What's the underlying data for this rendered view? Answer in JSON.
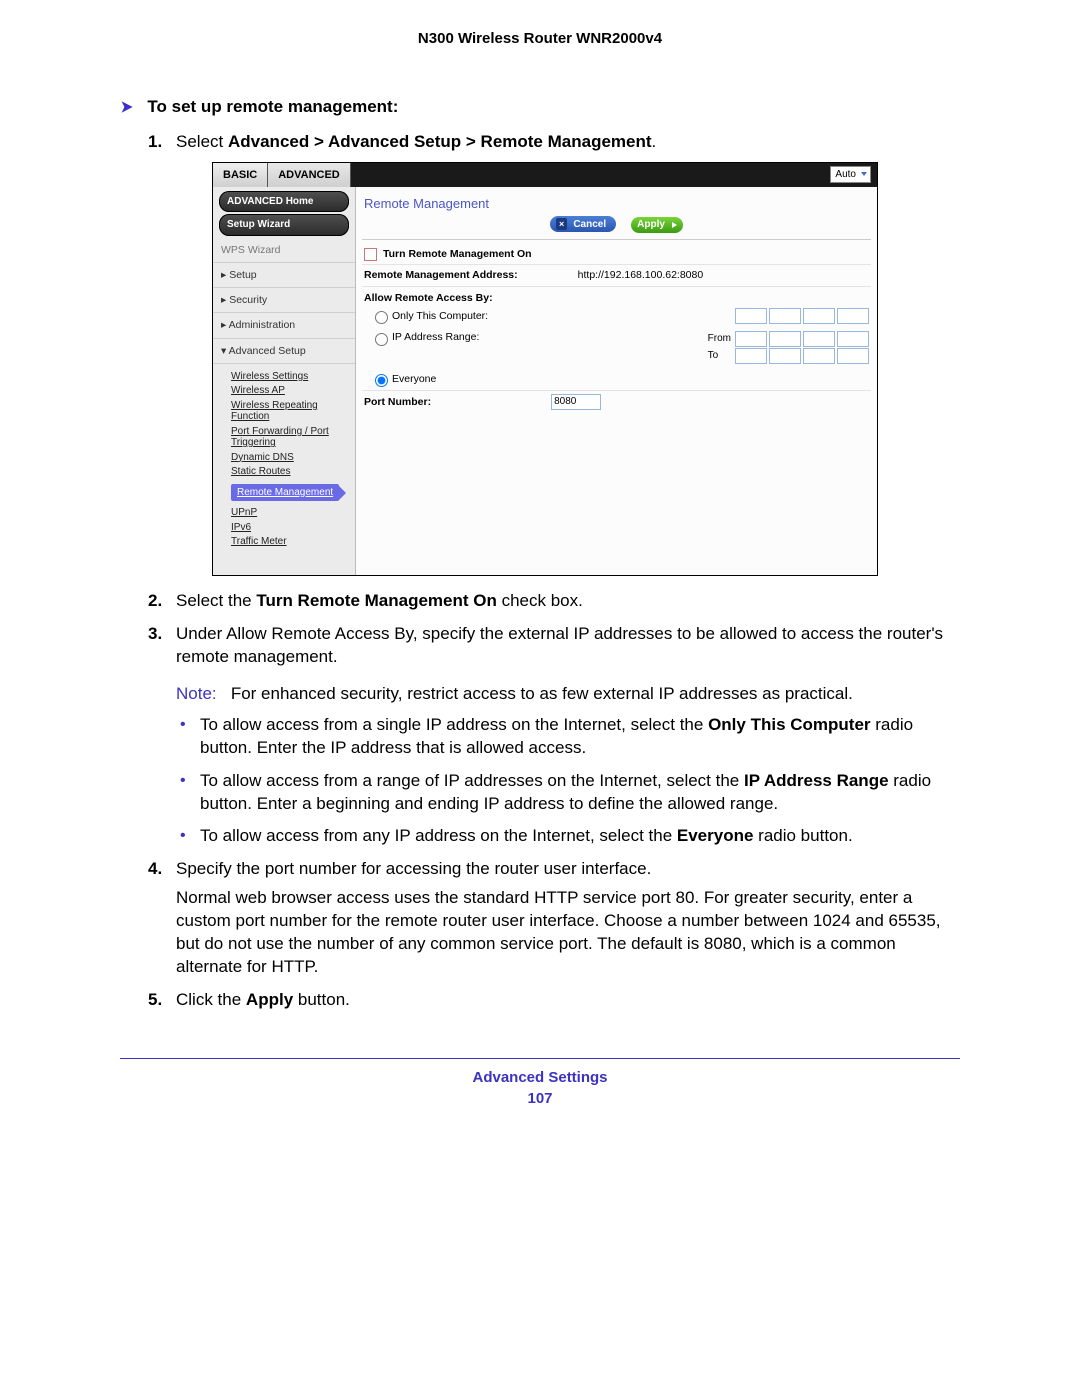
{
  "header": {
    "title": "N300 Wireless Router WNR2000v4"
  },
  "procedure": {
    "heading": "To set up remote management:"
  },
  "steps": {
    "s1": {
      "num": "1.",
      "pre": "Select ",
      "bold": "Advanced > Advanced Setup > Remote Management",
      "post": "."
    },
    "s2": {
      "num": "2.",
      "pre": "Select the ",
      "bold": "Turn Remote Management On",
      "post": " check box."
    },
    "s3": {
      "num": "3.",
      "text": "Under Allow Remote Access By, specify the external IP addresses to be allowed to access the router's remote management.",
      "note_label": "Note:",
      "note_text": "For enhanced security, restrict access to as few external IP addresses as practical.",
      "bullets": {
        "b1": {
          "pre": "To allow access from a single IP address on the Internet, select the ",
          "bold": "Only This Computer",
          "post": " radio button. Enter the IP address that is allowed access."
        },
        "b2": {
          "pre": "To allow access from a range of IP addresses on the Internet, select the ",
          "bold": "IP Address Range",
          "post": " radio button. Enter a beginning and ending IP address to define the allowed range."
        },
        "b3": {
          "pre": "To allow access from any IP address on the Internet, select the ",
          "bold": "Everyone",
          "post": " radio button."
        }
      }
    },
    "s4": {
      "num": "4.",
      "text": "Specify the port number for accessing the router user interface.",
      "para": "Normal web browser access uses the standard HTTP service port 80. For greater security, enter a custom port number for the remote router user interface. Choose a number between 1024 and 65535, but do not use the number of any common service port. The default is 8080, which is a common alternate for HTTP."
    },
    "s5": {
      "num": "5.",
      "pre": "Click the ",
      "bold": "Apply",
      "post": " button."
    }
  },
  "router": {
    "tabs": {
      "basic": "BASIC",
      "advanced": "ADVANCED"
    },
    "lang": "Auto",
    "pills": {
      "home": "ADVANCED Home",
      "wizard": "Setup Wizard"
    },
    "nav": {
      "wps": "WPS Wizard",
      "setup": "▸ Setup",
      "security": "▸ Security",
      "admin": "▸ Administration",
      "advsetup": "▾ Advanced Setup"
    },
    "sub": {
      "ws": "Wireless Settings",
      "ap": "Wireless AP",
      "wrf": "Wireless Repeating Function",
      "pf": "Port Forwarding / Port Triggering",
      "ddns": "Dynamic DNS",
      "sr": "Static Routes",
      "rm": "Remote Management",
      "upnp": "UPnP",
      "ipv6": "IPv6",
      "tm": "Traffic Meter"
    },
    "content": {
      "title": "Remote Management",
      "cancel": "Cancel",
      "apply": "Apply",
      "turn_on": "Turn Remote Management On",
      "addr_label": "Remote Management Address:",
      "addr_value": "http://192.168.100.62:8080",
      "allow_label": "Allow Remote Access By:",
      "only_this": "Only This Computer:",
      "ip_range": "IP Address Range:",
      "from": "From",
      "to": "To",
      "everyone": "Everyone",
      "port_label": "Port Number:",
      "port_value": "8080"
    }
  },
  "footer": {
    "section": "Advanced Settings",
    "page": "107"
  }
}
